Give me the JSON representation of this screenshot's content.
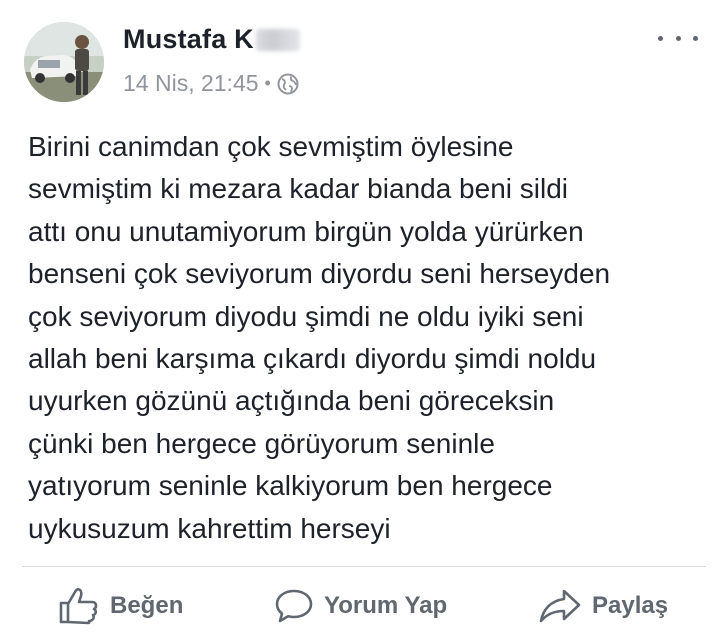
{
  "post": {
    "author": {
      "name": "Mustafa K"
    },
    "timestamp": "14 Nis, 21:45",
    "separator": "•",
    "privacy_icon": "globe-icon",
    "more_icon": "more-options-icon",
    "text": "Birini canimdan çok sevmiştim öylesine\nsevmiştim ki mezara kadar bianda beni sildi\nattı onu unutamiyorum birgün yolda yürürken\nbenseni çok seviyorum diyordu seni herseyden\nçok seviyorum diyodu şimdi ne oldu iyiki seni\nallah beni karşıma çıkardı diyordu şimdi noldu\nuyurken gözünü açtığında beni göreceksin\nçünki ben hergece görüyorum seninle\nyatıyorum seninle kalkiyorum ben hergece\nuykusuzum kahrettim herseyi"
  },
  "actions": {
    "like": {
      "label": "Beğen",
      "icon": "thumbs-up-icon"
    },
    "comment": {
      "label": "Yorum Yap",
      "icon": "comment-icon"
    },
    "share": {
      "label": "Paylaş",
      "icon": "share-icon"
    }
  },
  "colors": {
    "text": "#1d2129",
    "meta": "#90949c",
    "action": "#606770",
    "divider": "#dadde1"
  }
}
